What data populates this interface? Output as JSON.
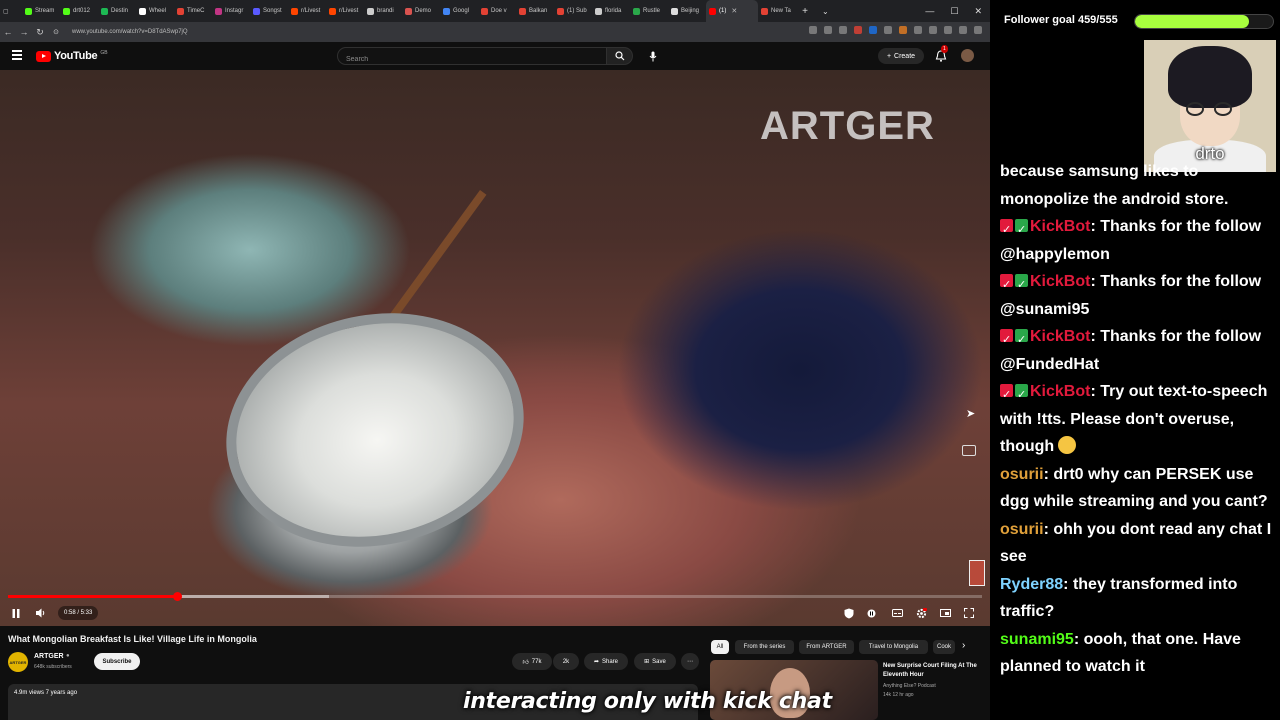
{
  "browser": {
    "tabs": [
      {
        "label": "Stream",
        "color": "#53fc18"
      },
      {
        "label": "drt012",
        "color": "#53fc18"
      },
      {
        "label": "Destin",
        "color": "#1db954"
      },
      {
        "label": "Wheel",
        "color": "#ffffff"
      },
      {
        "label": "TimeC",
        "color": "#e34234"
      },
      {
        "label": "Instagr",
        "color": "#c13584"
      },
      {
        "label": "Songst",
        "color": "#5a5aff"
      },
      {
        "label": "r/Livest",
        "color": "#ff4500"
      },
      {
        "label": "r/Livest",
        "color": "#ff4500"
      },
      {
        "label": "brandi",
        "color": "#cccccc"
      },
      {
        "label": "Demo",
        "color": "#d9534f"
      },
      {
        "label": "Googl",
        "color": "#4285f4"
      },
      {
        "label": "Doe v",
        "color": "#e34234"
      },
      {
        "label": "Balkan",
        "color": "#e34234"
      },
      {
        "label": "(1) Sub",
        "color": "#e34234"
      },
      {
        "label": "florida",
        "color": "#cccccc"
      },
      {
        "label": "Rustle",
        "color": "#2aa84a"
      },
      {
        "label": "Beijing",
        "color": "#dddddd"
      },
      {
        "label": "(1)",
        "color": "#ff0000",
        "active": true
      },
      {
        "label": "New Ta",
        "color": "#e34234"
      }
    ],
    "url": "www.youtube.com/watch?v=D8TdASwp7jQ"
  },
  "youtube": {
    "logo_text": "YouTube",
    "logo_country": "GB",
    "search_placeholder": "Search",
    "create_label": "Create",
    "notification_count": "1"
  },
  "video": {
    "watermark": "ARTGER",
    "time_current": "0:58",
    "time_total": "5:33",
    "time_display": "0:58 / 5:33",
    "played_fraction": 0.174,
    "buffered_fraction": 0.33,
    "title": "What Mongolian Breakfast Is Like! Village Life in Mongolia",
    "channel": "ARTGER",
    "channel_avatar_text": "ARTGER",
    "subscribers": "648k subscribers",
    "subscribe_label": "Subscribe",
    "likes": "77k",
    "comments": "2k",
    "share_label": "Share",
    "save_label": "Save",
    "views": "4.9m views  7 years ago"
  },
  "chips": [
    "All",
    "From the series",
    "From ARTGER",
    "Travel to Mongolia",
    "Cook"
  ],
  "recommended": {
    "title": "New Surprise Court Filing At The Eleventh Hour",
    "channel": "Anything Else? Podcast",
    "meta": "14k  12 hr ago"
  },
  "caption": "interacting only with kick chat",
  "overlay": {
    "goal_label": "Follower goal 459/555",
    "goal_current": 459,
    "goal_target": 555,
    "goal_color": "#a8ff3e",
    "cam_name": "drto"
  },
  "chat": [
    {
      "user": "",
      "color": "#ffffff",
      "text": "because samsung likes to monopolize the android store."
    },
    {
      "user": "KickBot",
      "color": "#e21a3c",
      "badges": true,
      "text": "Thanks for the follow @happylemon"
    },
    {
      "user": "KickBot",
      "color": "#e21a3c",
      "badges": true,
      "text": "Thanks for the follow @sunami95"
    },
    {
      "user": "KickBot",
      "color": "#e21a3c",
      "badges": true,
      "text": "Thanks for the follow @FundedHat"
    },
    {
      "user": "KickBot",
      "color": "#e21a3c",
      "badges": true,
      "text": "Try out text-to-speech with !tts. Please don't overuse, though",
      "emote": true
    },
    {
      "user": "osurii",
      "color": "#e0a03a",
      "text": "drt0 why can PERSEK use dgg while streaming and you cant?"
    },
    {
      "user": "osurii",
      "color": "#e0a03a",
      "text": "ohh you dont read any chat I see"
    },
    {
      "user": "Ryder88",
      "color": "#7fd3ff",
      "text": "they transformed into traffic?"
    },
    {
      "user": "sunami95",
      "color": "#53fc18",
      "text": "oooh, that one. Have planned to watch it"
    }
  ]
}
